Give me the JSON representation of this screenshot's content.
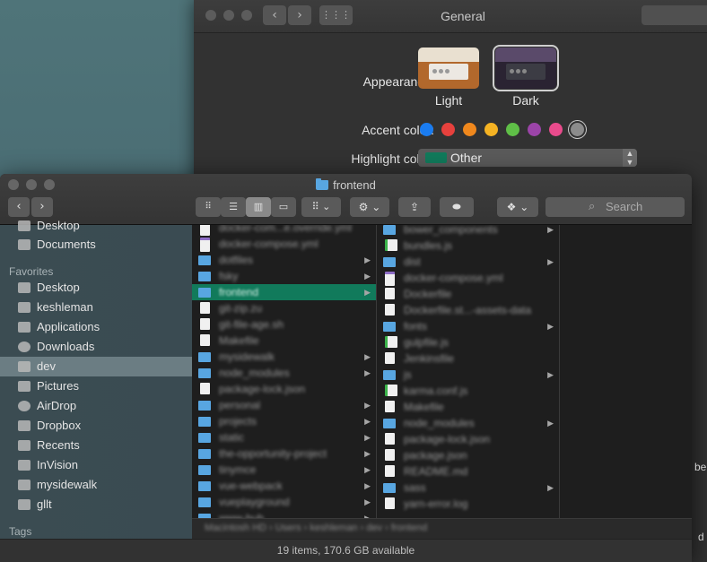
{
  "prefs": {
    "title": "General",
    "appearance_label": "Appearance:",
    "appearance_options": [
      "Light",
      "Dark"
    ],
    "appearance_selected": "Dark",
    "accent_label": "Accent color:",
    "accent_colors": [
      "#1a7cf0",
      "#e7413d",
      "#f0881d",
      "#f5b323",
      "#5fbf47",
      "#9b44a8",
      "#e94b8c",
      "#8c8c8c"
    ],
    "accent_selected_index": 7,
    "highlight_label": "Highlight color:",
    "highlight_value": "Other",
    "highlight_color": "#117a5b",
    "search_icon": "⌕",
    "edge_text_1": "be",
    "edge_text_2": "d"
  },
  "finder": {
    "title": "frontend",
    "search_placeholder": "Search",
    "view_modes": [
      "icon-view",
      "list-view",
      "column-view",
      "gallery-view"
    ],
    "active_view": "column-view",
    "sidebar": {
      "items_top": [
        "Desktop",
        "Documents"
      ],
      "favorites_heading": "Favorites",
      "favorites": [
        "Desktop",
        "keshleman",
        "Applications",
        "Downloads",
        "dev",
        "Pictures",
        "AirDrop",
        "Dropbox",
        "Recents",
        "InVision",
        "mysidewalk",
        "gllt"
      ],
      "selected": "dev",
      "tags_heading": "Tags"
    },
    "column1": [
      {
        "name": "docker-com...e.override.yml",
        "type": "purple",
        "folder": false
      },
      {
        "name": "docker-compose.yml",
        "type": "purple",
        "folder": false
      },
      {
        "name": "dotfiles",
        "type": "folder",
        "folder": true
      },
      {
        "name": "fsky",
        "type": "folder",
        "folder": true
      },
      {
        "name": "frontend",
        "type": "folder",
        "folder": true,
        "selected": true
      },
      {
        "name": "git-zip.zu",
        "type": "doc",
        "folder": false
      },
      {
        "name": "git-file-age.sh",
        "type": "doc",
        "folder": false
      },
      {
        "name": "Makefile",
        "type": "doc",
        "folder": false
      },
      {
        "name": "mysidewalk",
        "type": "folder",
        "folder": true
      },
      {
        "name": "node_modules",
        "type": "folder",
        "folder": true
      },
      {
        "name": "package-lock.json",
        "type": "doc",
        "folder": false
      },
      {
        "name": "personal",
        "type": "folder",
        "folder": true
      },
      {
        "name": "projects",
        "type": "folder",
        "folder": true
      },
      {
        "name": "static",
        "type": "folder",
        "folder": true
      },
      {
        "name": "the-opportunity-project",
        "type": "folder",
        "folder": true
      },
      {
        "name": "tinymce",
        "type": "folder",
        "folder": true
      },
      {
        "name": "vue-webpack",
        "type": "folder",
        "folder": true
      },
      {
        "name": "vueplayground",
        "type": "folder",
        "folder": true
      },
      {
        "name": "www-hub",
        "type": "folder",
        "folder": true
      }
    ],
    "column2": [
      {
        "name": "bower_components",
        "type": "folder",
        "folder": true
      },
      {
        "name": "bundles.js",
        "type": "green",
        "folder": false
      },
      {
        "name": "dist",
        "type": "folder",
        "folder": true
      },
      {
        "name": "docker-compose.yml",
        "type": "purple",
        "folder": false
      },
      {
        "name": "Dockerfile",
        "type": "doc",
        "folder": false
      },
      {
        "name": "Dockerfile.st...-assets-data",
        "type": "doc",
        "folder": false
      },
      {
        "name": "fonts",
        "type": "folder",
        "folder": true
      },
      {
        "name": "gulpfile.js",
        "type": "green",
        "folder": false
      },
      {
        "name": "Jenkinsfile",
        "type": "doc",
        "folder": false
      },
      {
        "name": "js",
        "type": "folder",
        "folder": true
      },
      {
        "name": "karma.conf.js",
        "type": "green",
        "folder": false
      },
      {
        "name": "Makefile",
        "type": "doc",
        "folder": false
      },
      {
        "name": "node_modules",
        "type": "folder",
        "folder": true
      },
      {
        "name": "package-lock.json",
        "type": "doc",
        "folder": false
      },
      {
        "name": "package.json",
        "type": "doc",
        "folder": false
      },
      {
        "name": "README.md",
        "type": "doc",
        "folder": false
      },
      {
        "name": "sass",
        "type": "folder",
        "folder": true
      },
      {
        "name": "yarn-error.log",
        "type": "doc",
        "folder": false
      }
    ],
    "path": "Macintosh HD › Users › keshleman › dev › frontend",
    "status": "19 items, 170.6 GB available"
  }
}
